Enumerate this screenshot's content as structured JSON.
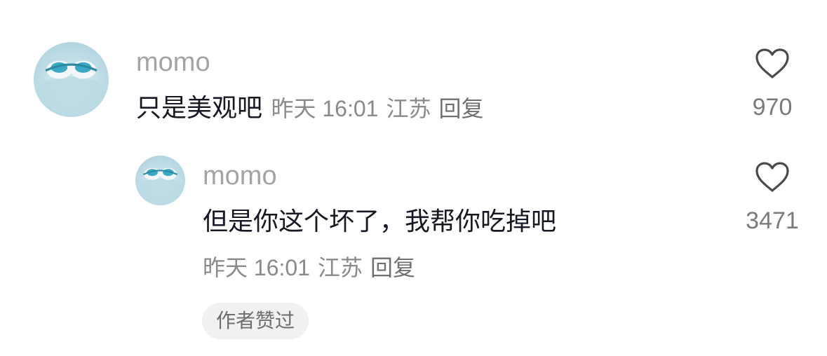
{
  "comments": [
    {
      "username": "momo",
      "content": "只是美观吧",
      "time": "昨天 16:01",
      "location": "江苏",
      "reply_label": "回复",
      "like_count": "970",
      "avatar_icon": "blue-plush-avatar-icon"
    }
  ],
  "replies": [
    {
      "username": "momo",
      "content": "但是你这个坏了，我帮你吃掉吧",
      "time": "昨天 16:01",
      "location": "江苏",
      "reply_label": "回复",
      "like_count": "3471",
      "badge": "作者赞过",
      "avatar_icon": "blue-plush-avatar-icon"
    }
  ],
  "colors": {
    "username": "#a3a3a3",
    "content": "#161823",
    "meta": "#8a8a8a",
    "badge_bg": "#f1f1f2"
  },
  "icons": {
    "like": "heart-outline-icon"
  }
}
